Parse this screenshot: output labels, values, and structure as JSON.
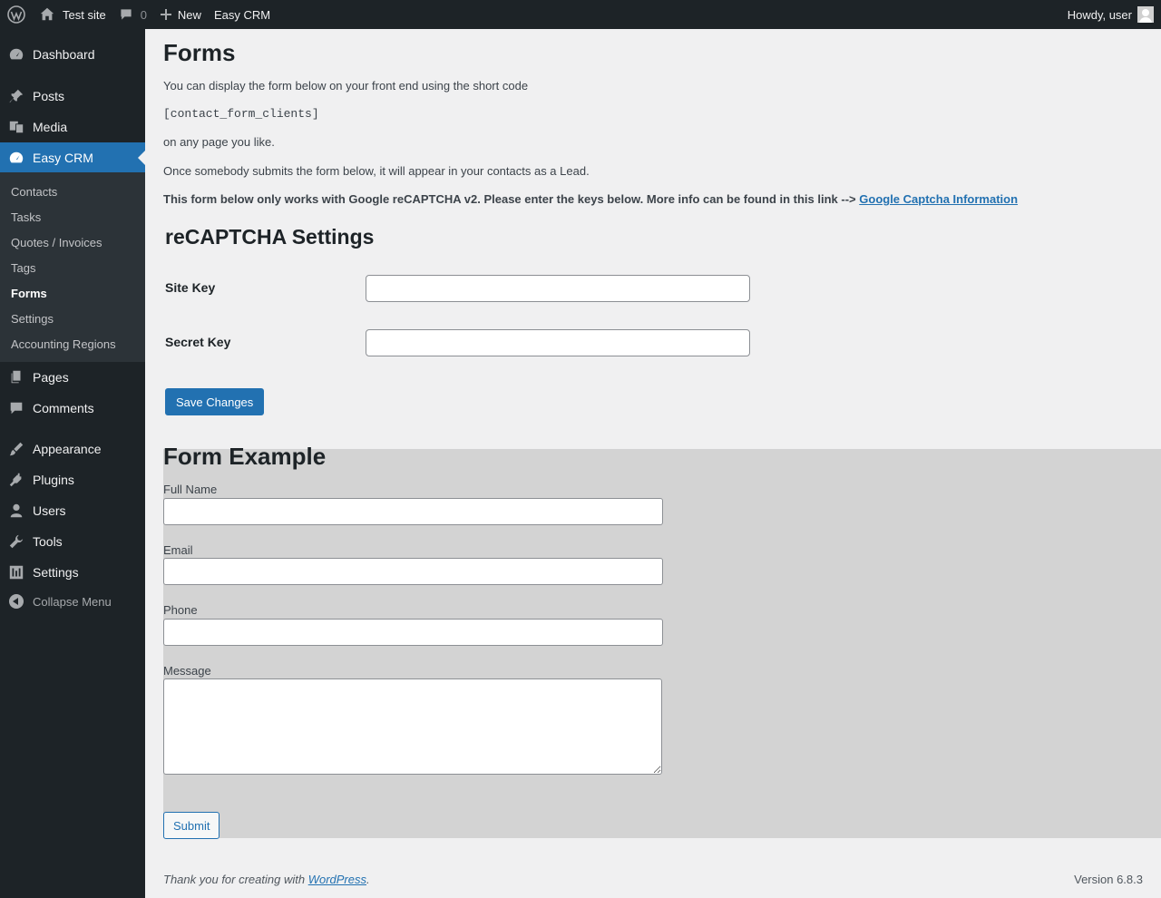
{
  "adminbar": {
    "site_name": "Test site",
    "comments_count": "0",
    "new_label": "New",
    "plugin_label": "Easy CRM",
    "howdy": "Howdy, user"
  },
  "sidebar": {
    "dashboard": "Dashboard",
    "posts": "Posts",
    "media": "Media",
    "easy_crm": "Easy CRM",
    "submenu": [
      "Contacts",
      "Tasks",
      "Quotes / Invoices",
      "Tags",
      "Forms",
      "Settings",
      "Accounting Regions"
    ],
    "pages": "Pages",
    "comments": "Comments",
    "appearance": "Appearance",
    "plugins": "Plugins",
    "users": "Users",
    "tools": "Tools",
    "settings": "Settings",
    "collapse": "Collapse Menu"
  },
  "main": {
    "title": "Forms",
    "intro": "You can display the form below on your front end using the short code",
    "shortcode": "[contact_form_clients]",
    "any_page": "on any page you like.",
    "lead_note": "Once somebody submits the form below, it will appear in your contacts as a Lead.",
    "captcha_note": "This form below only works with Google reCAPTCHA v2. Please enter the keys below. More info can be found in this link -->",
    "captcha_link": "Google Captcha Information",
    "settings_heading": "reCAPTCHA Settings",
    "site_key_label": "Site Key",
    "site_key_value": "",
    "secret_key_label": "Secret Key",
    "secret_key_value": "",
    "save_button": "Save Changes"
  },
  "example": {
    "title": "Form Example",
    "full_name_label": "Full Name",
    "email_label": "Email",
    "phone_label": "Phone",
    "message_label": "Message",
    "submit_button": "Submit"
  },
  "footer": {
    "thanks_prefix": "Thank you for creating with ",
    "wp_link": "WordPress",
    "thanks_suffix": ".",
    "version": "Version 6.8.3"
  },
  "colors": {
    "adminbar_bg": "#1d2327",
    "accent": "#2271b1",
    "content_bg": "#f0f0f1",
    "example_bg": "#d3d3d3"
  }
}
